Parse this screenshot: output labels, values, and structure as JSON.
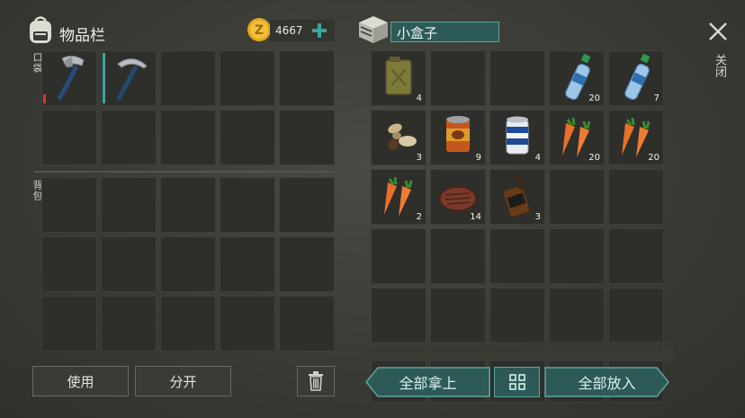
{
  "inventory": {
    "title": "物品栏",
    "coins": "4667",
    "section_pocket": "口袋",
    "section_backpack": "背包",
    "pocket_items": [
      {
        "icon": "axe-icon",
        "count": ""
      },
      {
        "icon": "pickaxe-icon",
        "count": ""
      }
    ]
  },
  "container": {
    "title": "小盒子",
    "items": [
      {
        "icon": "jerrycan-icon",
        "count": "4"
      },
      {
        "icon": "",
        "count": ""
      },
      {
        "icon": "",
        "count": ""
      },
      {
        "icon": "water-bottle-icon",
        "count": "20"
      },
      {
        "icon": "water-bottle-icon",
        "count": "7"
      },
      {
        "icon": "mushroom-icon",
        "count": "3"
      },
      {
        "icon": "canned-food-icon",
        "count": "9"
      },
      {
        "icon": "beer-can-icon",
        "count": "4"
      },
      {
        "icon": "carrot-icon",
        "count": "20"
      },
      {
        "icon": "carrot-icon",
        "count": "20"
      },
      {
        "icon": "carrot-icon",
        "count": "2"
      },
      {
        "icon": "steak-icon",
        "count": "14"
      },
      {
        "icon": "whiskey-bottle-icon",
        "count": "3"
      }
    ]
  },
  "buttons": {
    "use": "使用",
    "split": "分开",
    "take_all": "全部拿上",
    "put_all": "全部放入",
    "close": "关闭"
  },
  "colors": {
    "accent": "#2d5a57",
    "accent_border": "#5fa49e",
    "coin": "#e0a820"
  }
}
